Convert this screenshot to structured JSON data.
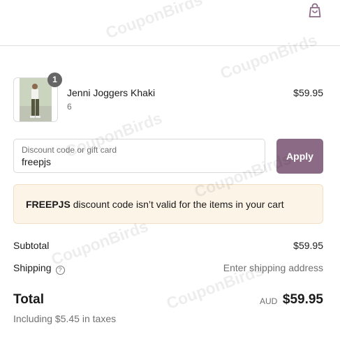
{
  "watermark": "CouponBirds",
  "header": {
    "cart_icon": "shopping-bag-icon"
  },
  "line_item": {
    "quantity": "1",
    "title": "Jenni Joggers Khaki",
    "variant": "6",
    "price": "$59.95"
  },
  "discount": {
    "placeholder": "Discount code or gift card",
    "value": "freepjs",
    "apply_label": "Apply"
  },
  "notice": {
    "code": "FREEPJS",
    "message": " discount code isn’t valid for the items in your cart"
  },
  "summary": {
    "subtotal_label": "Subtotal",
    "subtotal_value": "$59.95",
    "shipping_label": "Shipping",
    "shipping_help": "?",
    "shipping_value": "Enter shipping address",
    "total_label": "Total",
    "currency": "AUD",
    "total_value": "$59.95",
    "taxes_note": "Including $5.45 in taxes"
  },
  "colors": {
    "accent": "#8a6a84",
    "notice_bg": "#fdf4e8"
  }
}
